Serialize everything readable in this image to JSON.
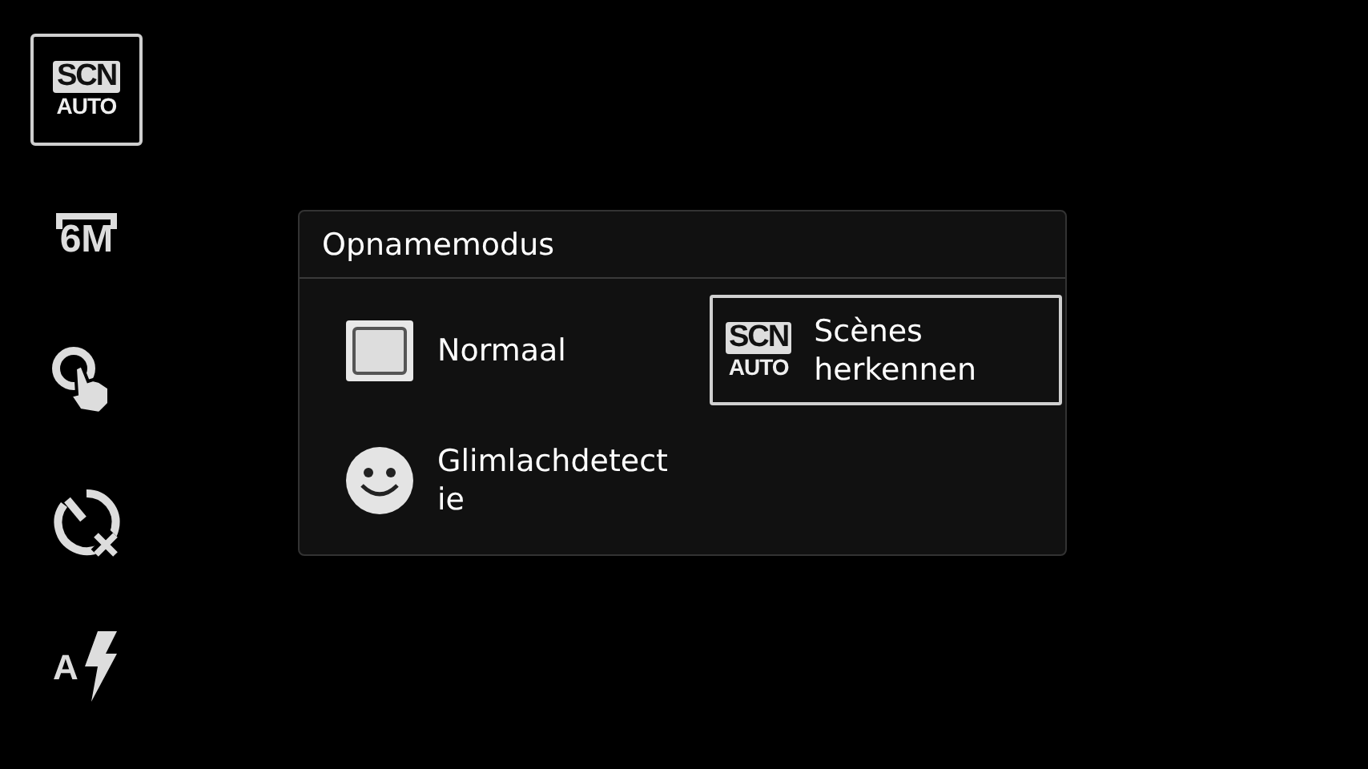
{
  "sidebar": {
    "items": [
      {
        "kind": "scn",
        "selected": true,
        "texts": [
          "SCN",
          "AUTO"
        ]
      },
      {
        "kind": "size",
        "selected": false,
        "texts": [
          "6M"
        ]
      },
      {
        "kind": "touch",
        "selected": false
      },
      {
        "kind": "timer",
        "selected": false
      },
      {
        "kind": "flash",
        "selected": false,
        "texts": [
          "A"
        ]
      }
    ]
  },
  "dialog": {
    "title": "Opnamemodus",
    "options": [
      {
        "kind": "normal",
        "selected": false,
        "lines": [
          "Normaal"
        ]
      },
      {
        "kind": "scn",
        "selected": true,
        "lines": [
          "Scènes",
          "herkennen"
        ],
        "icon_texts": [
          "SCN",
          "AUTO"
        ]
      },
      {
        "kind": "smile",
        "selected": false,
        "lines": [
          "Glimlachdetect",
          "ie"
        ]
      }
    ]
  }
}
